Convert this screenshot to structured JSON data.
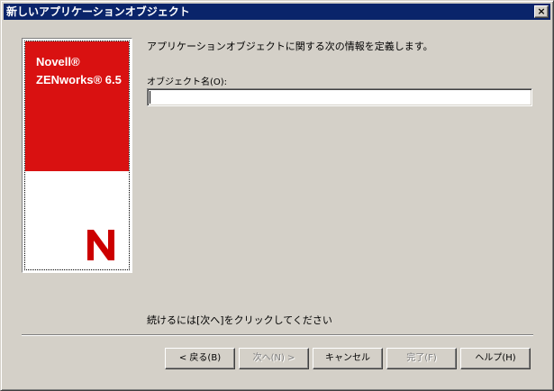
{
  "window": {
    "title": "新しいアプリケーションオブジェクト",
    "close_glyph": "×"
  },
  "logo": {
    "line1": "Novell®",
    "line2": "ZENworks® 6.5",
    "brand_color": "#cc0000"
  },
  "main": {
    "intro": "アプリケーションオブジェクトに関する次の情報を定義します。",
    "object_name_label": "オブジェクト名(O):",
    "object_name_value": "",
    "continue_text": "続けるには[次へ]をクリックしてください"
  },
  "buttons": {
    "back": "< 戻る(B)",
    "next": "次へ(N) >",
    "cancel": "キャンセル",
    "finish": "完了(F)",
    "help": "ヘルプ(H)"
  }
}
